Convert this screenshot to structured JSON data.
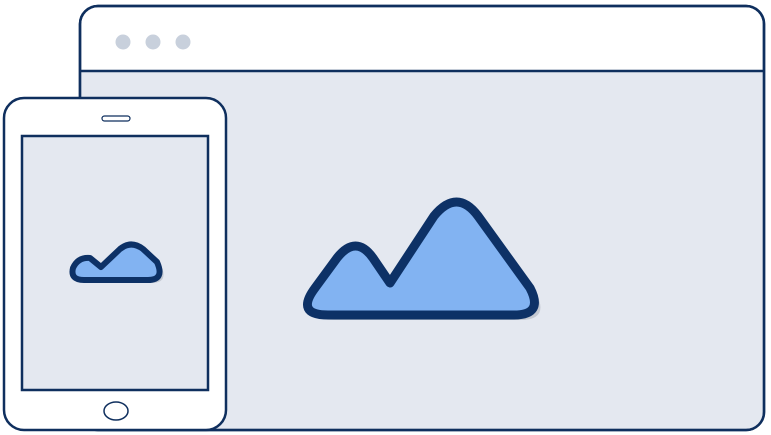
{
  "colors": {
    "outline": "#0f2f5e",
    "mountain_stroke": "#0d3166",
    "mountain_fill": "#82b3f2",
    "screen_fill": "#e4e8f0",
    "frame_fill": "#ffffff",
    "window_dots": "#c8d0dc",
    "shadow": "#c4c9d2"
  },
  "browser_window": {
    "control_dots": [
      "dot-1",
      "dot-2",
      "dot-3"
    ],
    "content_icon": "mountain-image-icon"
  },
  "tablet": {
    "content_icon": "mountain-image-icon",
    "controls": [
      "speaker-slot",
      "home-button"
    ]
  }
}
